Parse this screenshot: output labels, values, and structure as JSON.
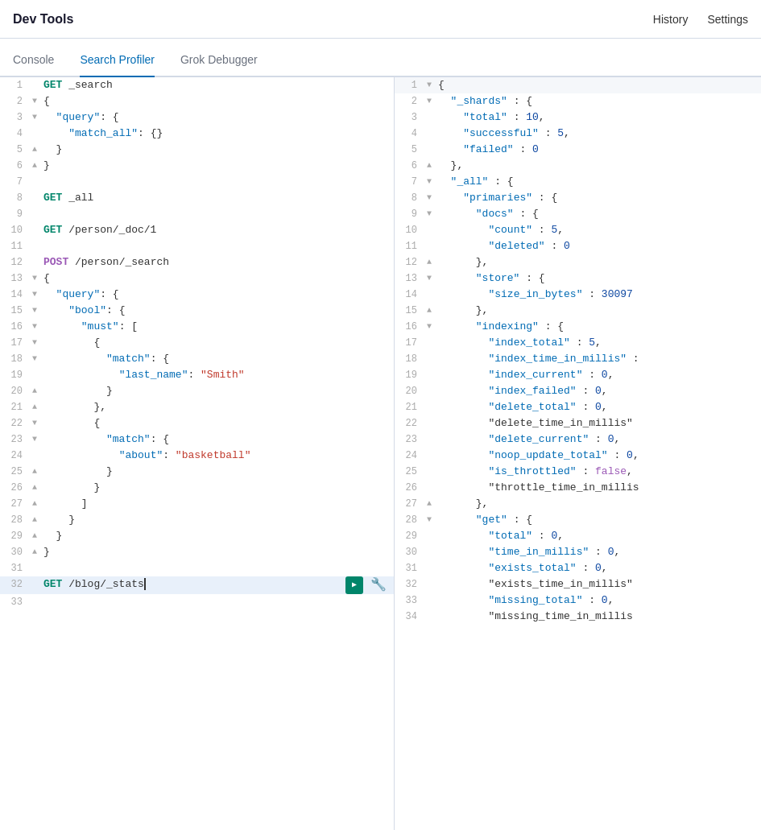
{
  "header": {
    "title": "Dev Tools",
    "history_label": "History",
    "settings_label": "Settings"
  },
  "tabs": [
    {
      "id": "console",
      "label": "Console",
      "active": false
    },
    {
      "id": "search-profiler",
      "label": "Search Profiler",
      "active": true
    },
    {
      "id": "grok-debugger",
      "label": "Grok Debugger",
      "active": false
    }
  ],
  "editor": {
    "lines": [
      {
        "num": 1,
        "fold": "",
        "text": "GET _search",
        "type": "method",
        "highlighted": false
      },
      {
        "num": 2,
        "fold": "▼",
        "text": "{",
        "highlighted": false
      },
      {
        "num": 3,
        "fold": "▼",
        "text": "  \"query\": {",
        "highlighted": false
      },
      {
        "num": 4,
        "fold": "",
        "text": "    \"match_all\": {}",
        "highlighted": false
      },
      {
        "num": 5,
        "fold": "▲",
        "text": "  }",
        "highlighted": false
      },
      {
        "num": 6,
        "fold": "▲",
        "text": "}",
        "highlighted": false
      },
      {
        "num": 7,
        "fold": "",
        "text": "",
        "highlighted": false
      },
      {
        "num": 8,
        "fold": "",
        "text": "GET _all",
        "type": "method",
        "highlighted": false
      },
      {
        "num": 9,
        "fold": "",
        "text": "",
        "highlighted": false
      },
      {
        "num": 10,
        "fold": "",
        "text": "GET /person/_doc/1",
        "type": "method",
        "highlighted": false
      },
      {
        "num": 11,
        "fold": "",
        "text": "",
        "highlighted": false
      },
      {
        "num": 12,
        "fold": "",
        "text": "POST /person/_search",
        "type": "method",
        "highlighted": false
      },
      {
        "num": 13,
        "fold": "▼",
        "text": "{",
        "highlighted": false
      },
      {
        "num": 14,
        "fold": "▼",
        "text": "  \"query\": {",
        "highlighted": false
      },
      {
        "num": 15,
        "fold": "▼",
        "text": "    \"bool\": {",
        "highlighted": false
      },
      {
        "num": 16,
        "fold": "▼",
        "text": "      \"must\": [",
        "highlighted": false
      },
      {
        "num": 17,
        "fold": "▼",
        "text": "        {",
        "highlighted": false
      },
      {
        "num": 18,
        "fold": "▼",
        "text": "          \"match\": {",
        "highlighted": false
      },
      {
        "num": 19,
        "fold": "",
        "text": "            \"last_name\": \"Smith\"",
        "highlighted": false
      },
      {
        "num": 20,
        "fold": "▲",
        "text": "          }",
        "highlighted": false
      },
      {
        "num": 21,
        "fold": "▲",
        "text": "        },",
        "highlighted": false
      },
      {
        "num": 22,
        "fold": "▼",
        "text": "        {",
        "highlighted": false
      },
      {
        "num": 23,
        "fold": "▼",
        "text": "          \"match\": {",
        "highlighted": false
      },
      {
        "num": 24,
        "fold": "",
        "text": "            \"about\": \"basketball\"",
        "highlighted": false
      },
      {
        "num": 25,
        "fold": "▲",
        "text": "          }",
        "highlighted": false
      },
      {
        "num": 26,
        "fold": "▲",
        "text": "        }",
        "highlighted": false
      },
      {
        "num": 27,
        "fold": "▲",
        "text": "      ]",
        "highlighted": false
      },
      {
        "num": 28,
        "fold": "▲",
        "text": "    }",
        "highlighted": false
      },
      {
        "num": 29,
        "fold": "▲",
        "text": "  }",
        "highlighted": false
      },
      {
        "num": 30,
        "fold": "▲",
        "text": "}",
        "highlighted": false
      },
      {
        "num": 31,
        "fold": "",
        "text": "",
        "highlighted": false
      },
      {
        "num": 32,
        "fold": "",
        "text": "GET /blog/_stats",
        "type": "method",
        "active": true,
        "highlighted": true
      },
      {
        "num": 33,
        "fold": "",
        "text": "",
        "highlighted": false
      }
    ]
  },
  "result": {
    "lines": [
      {
        "num": 1,
        "fold": "▼",
        "text": "{",
        "header": true
      },
      {
        "num": 2,
        "fold": "▼",
        "text": "  \"_shards\" : {"
      },
      {
        "num": 3,
        "fold": "",
        "text": "    \"total\" : 10,"
      },
      {
        "num": 4,
        "fold": "",
        "text": "    \"successful\" : 5,"
      },
      {
        "num": 5,
        "fold": "",
        "text": "    \"failed\" : 0"
      },
      {
        "num": 6,
        "fold": "▲",
        "text": "  },"
      },
      {
        "num": 7,
        "fold": "▼",
        "text": "  \"_all\" : {"
      },
      {
        "num": 8,
        "fold": "▼",
        "text": "    \"primaries\" : {"
      },
      {
        "num": 9,
        "fold": "▼",
        "text": "      \"docs\" : {"
      },
      {
        "num": 10,
        "fold": "",
        "text": "        \"count\" : 5,"
      },
      {
        "num": 11,
        "fold": "",
        "text": "        \"deleted\" : 0"
      },
      {
        "num": 12,
        "fold": "▲",
        "text": "      },"
      },
      {
        "num": 13,
        "fold": "▼",
        "text": "      \"store\" : {"
      },
      {
        "num": 14,
        "fold": "",
        "text": "        \"size_in_bytes\" : 30097"
      },
      {
        "num": 15,
        "fold": "▲",
        "text": "      },"
      },
      {
        "num": 16,
        "fold": "▼",
        "text": "      \"indexing\" : {"
      },
      {
        "num": 17,
        "fold": "",
        "text": "        \"index_total\" : 5,"
      },
      {
        "num": 18,
        "fold": "",
        "text": "        \"index_time_in_millis\" :"
      },
      {
        "num": 19,
        "fold": "",
        "text": "        \"index_current\" : 0,"
      },
      {
        "num": 20,
        "fold": "",
        "text": "        \"index_failed\" : 0,"
      },
      {
        "num": 21,
        "fold": "",
        "text": "        \"delete_total\" : 0,"
      },
      {
        "num": 22,
        "fold": "",
        "text": "        \"delete_time_in_millis\""
      },
      {
        "num": 23,
        "fold": "",
        "text": "        \"delete_current\" : 0,"
      },
      {
        "num": 24,
        "fold": "",
        "text": "        \"noop_update_total\" : 0,"
      },
      {
        "num": 25,
        "fold": "",
        "text": "        \"is_throttled\" : false,"
      },
      {
        "num": 26,
        "fold": "",
        "text": "        \"throttle_time_in_millis"
      },
      {
        "num": 27,
        "fold": "▲",
        "text": "      },"
      },
      {
        "num": 28,
        "fold": "▼",
        "text": "      \"get\" : {"
      },
      {
        "num": 29,
        "fold": "",
        "text": "        \"total\" : 0,"
      },
      {
        "num": 30,
        "fold": "",
        "text": "        \"time_in_millis\" : 0,"
      },
      {
        "num": 31,
        "fold": "",
        "text": "        \"exists_total\" : 0,"
      },
      {
        "num": 32,
        "fold": "",
        "text": "        \"exists_time_in_millis\""
      },
      {
        "num": 33,
        "fold": "",
        "text": "        \"missing_total\" : 0,"
      },
      {
        "num": 34,
        "fold": "",
        "text": "        \"missing_time_in_millis"
      }
    ]
  },
  "colors": {
    "method_get": "#00856a",
    "method_post": "#9b59b6",
    "key": "#006bb4",
    "string": "#c0392b",
    "number": "#0d47a1",
    "bool": "#9b59b6",
    "active_bg": "#e8f0fa",
    "tab_active": "#006bb4"
  }
}
